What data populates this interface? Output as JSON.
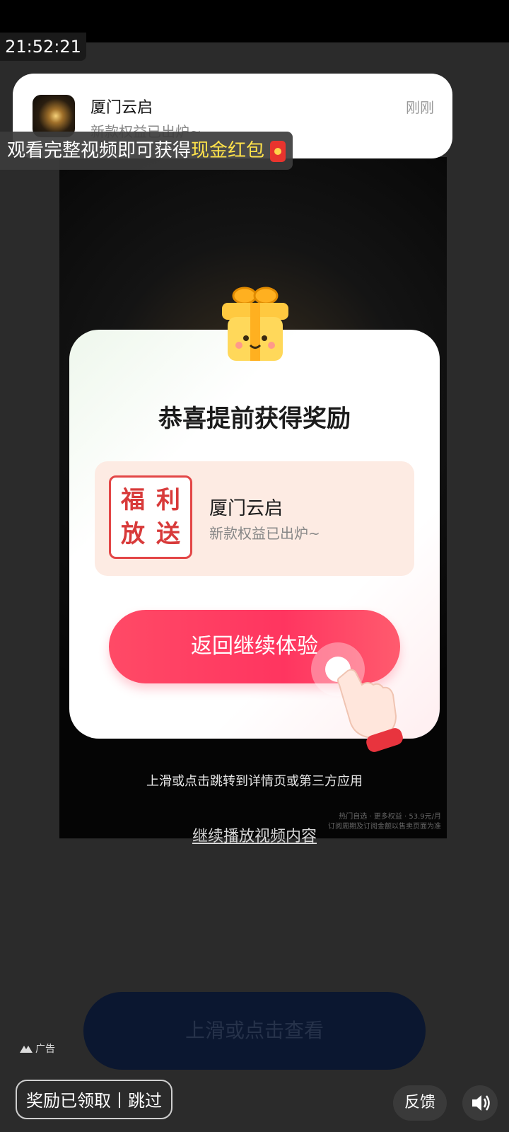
{
  "status_bar": {
    "time": "21:52:21"
  },
  "notification": {
    "icon": "app-logo-galaxy",
    "title": "厦门云启",
    "subtitle": "新款权益已出炉~",
    "time": "刚刚"
  },
  "banner": {
    "text_prefix": "观看完整视频即可获得",
    "text_highlight": "现金红包",
    "icon": "red-envelope-icon",
    "highlight_color": "#ffe24a"
  },
  "reward_card": {
    "title": "恭喜提前获得奖励",
    "promo": {
      "image_chars": [
        "福",
        "利",
        "放",
        "送"
      ],
      "title": "厦门云启",
      "subtitle": "新款权益已出炉~"
    },
    "cta_label": "返回继续体验",
    "cta_color": "#ff3d63"
  },
  "hint": "上滑或点击跳转到详情页或第三方应用",
  "fine_print": [
    "热门自选 · 更多权益 · 53.9元/月",
    "订阅周期及订阅金额以售卖页面为准"
  ],
  "continue_link": "继续播放视频内容",
  "bottom_cta": "上滑或点击查看",
  "ad_label": "广告",
  "skip_button": "奖励已领取丨跳过",
  "feedback_button": "反馈",
  "sound_icon": "speaker-icon"
}
